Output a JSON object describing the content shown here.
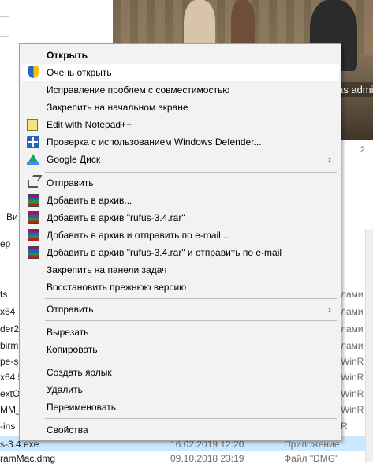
{
  "background": {
    "video_overlay_text": "as admini",
    "sidebar_labels": [
      "Ви",
      "ер",
      "ts",
      "x64",
      "der2",
      "birm",
      "pe-se",
      "x64 5",
      "extO",
      "MM_3",
      "-ins",
      "s-3.4.exe",
      "ramMac.dmg"
    ],
    "right_column_labels": [
      "лами",
      "лами",
      "лами",
      "лами",
      "WinR",
      "WinR",
      "WinR",
      "WinR",
      "R"
    ],
    "selected_row": {
      "name": "s-3.4.exe",
      "date": "16.02.2019 12:20",
      "type": "Приложение"
    },
    "last_row": {
      "name": "ramMac.dmg",
      "date": "09.10.2018 23:19",
      "type": "Файл \"DMG\""
    },
    "strip_number": "2"
  },
  "menu": {
    "items": [
      {
        "label": "Открыть",
        "icon": "none",
        "bold": true
      },
      {
        "label": "Очень открыть",
        "icon": "uac-shield-icon",
        "highlighted": true
      },
      {
        "label": "Исправление проблем с совместимостью",
        "icon": "none"
      },
      {
        "label": "Закрепить на начальном экране",
        "icon": "none"
      },
      {
        "label": "Edit with Notepad++",
        "icon": "notepad-plus-plus-icon"
      },
      {
        "label": "Проверка с использованием Windows Defender...",
        "icon": "windows-defender-icon"
      },
      {
        "label": "Google Диск",
        "icon": "google-drive-icon",
        "submenu": true
      },
      {
        "label": "Отправить",
        "icon": "share-icon"
      },
      {
        "label": "Добавить в архив...",
        "icon": "winrar-icon"
      },
      {
        "label": "Добавить в архив \"rufus-3.4.rar\"",
        "icon": "winrar-icon"
      },
      {
        "label": "Добавить в архив и отправить по e-mail...",
        "icon": "winrar-icon"
      },
      {
        "label": "Добавить в архив \"rufus-3.4.rar\" и отправить по e-mail",
        "icon": "winrar-icon"
      },
      {
        "label": "Закрепить на панели задач",
        "icon": "none"
      },
      {
        "label": "Восстановить прежнюю версию",
        "icon": "none"
      },
      {
        "label": "Отправить",
        "icon": "none",
        "submenu": true
      },
      {
        "label": "Вырезать",
        "icon": "none"
      },
      {
        "label": "Копировать",
        "icon": "none"
      },
      {
        "label": "Создать ярлык",
        "icon": "none"
      },
      {
        "label": "Удалить",
        "icon": "none"
      },
      {
        "label": "Переименовать",
        "icon": "none"
      },
      {
        "label": "Свойства",
        "icon": "none"
      }
    ],
    "submenu_arrow": "›"
  },
  "colors": {
    "menu_bg": "#f2f2f2",
    "highlight_bg": "#ffffff",
    "selected_row_bg": "#cce8ff"
  }
}
